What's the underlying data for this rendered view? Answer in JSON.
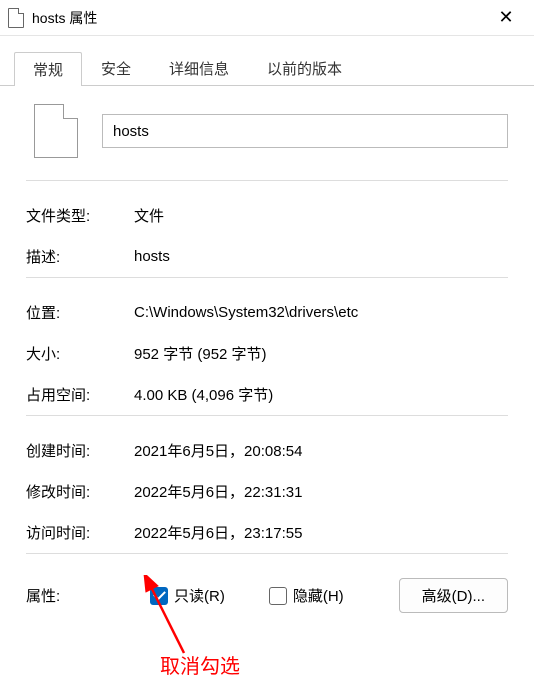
{
  "window": {
    "title": "hosts 属性",
    "close": "✕"
  },
  "tabs": {
    "general": "常规",
    "security": "安全",
    "details": "详细信息",
    "previous": "以前的版本"
  },
  "header": {
    "filename": "hosts"
  },
  "fields": {
    "type_label": "文件类型:",
    "type_value": "文件",
    "desc_label": "描述:",
    "desc_value": "hosts",
    "location_label": "位置:",
    "location_value": "C:\\Windows\\System32\\drivers\\etc",
    "size_label": "大小:",
    "size_value": "952 字节 (952 字节)",
    "disk_label": "占用空间:",
    "disk_value": "4.00 KB (4,096 字节)",
    "created_label": "创建时间:",
    "created_value": "2021年6月5日，20:08:54",
    "modified_label": "修改时间:",
    "modified_value": "2022年5月6日，22:31:31",
    "accessed_label": "访问时间:",
    "accessed_value": "2022年5月6日，23:17:55"
  },
  "attributes": {
    "label": "属性:",
    "readonly_label": "只读(R)",
    "readonly_checked": true,
    "hidden_label": "隐藏(H)",
    "hidden_checked": false,
    "advanced_label": "高级(D)..."
  },
  "annotation": {
    "text": "取消勾选"
  }
}
